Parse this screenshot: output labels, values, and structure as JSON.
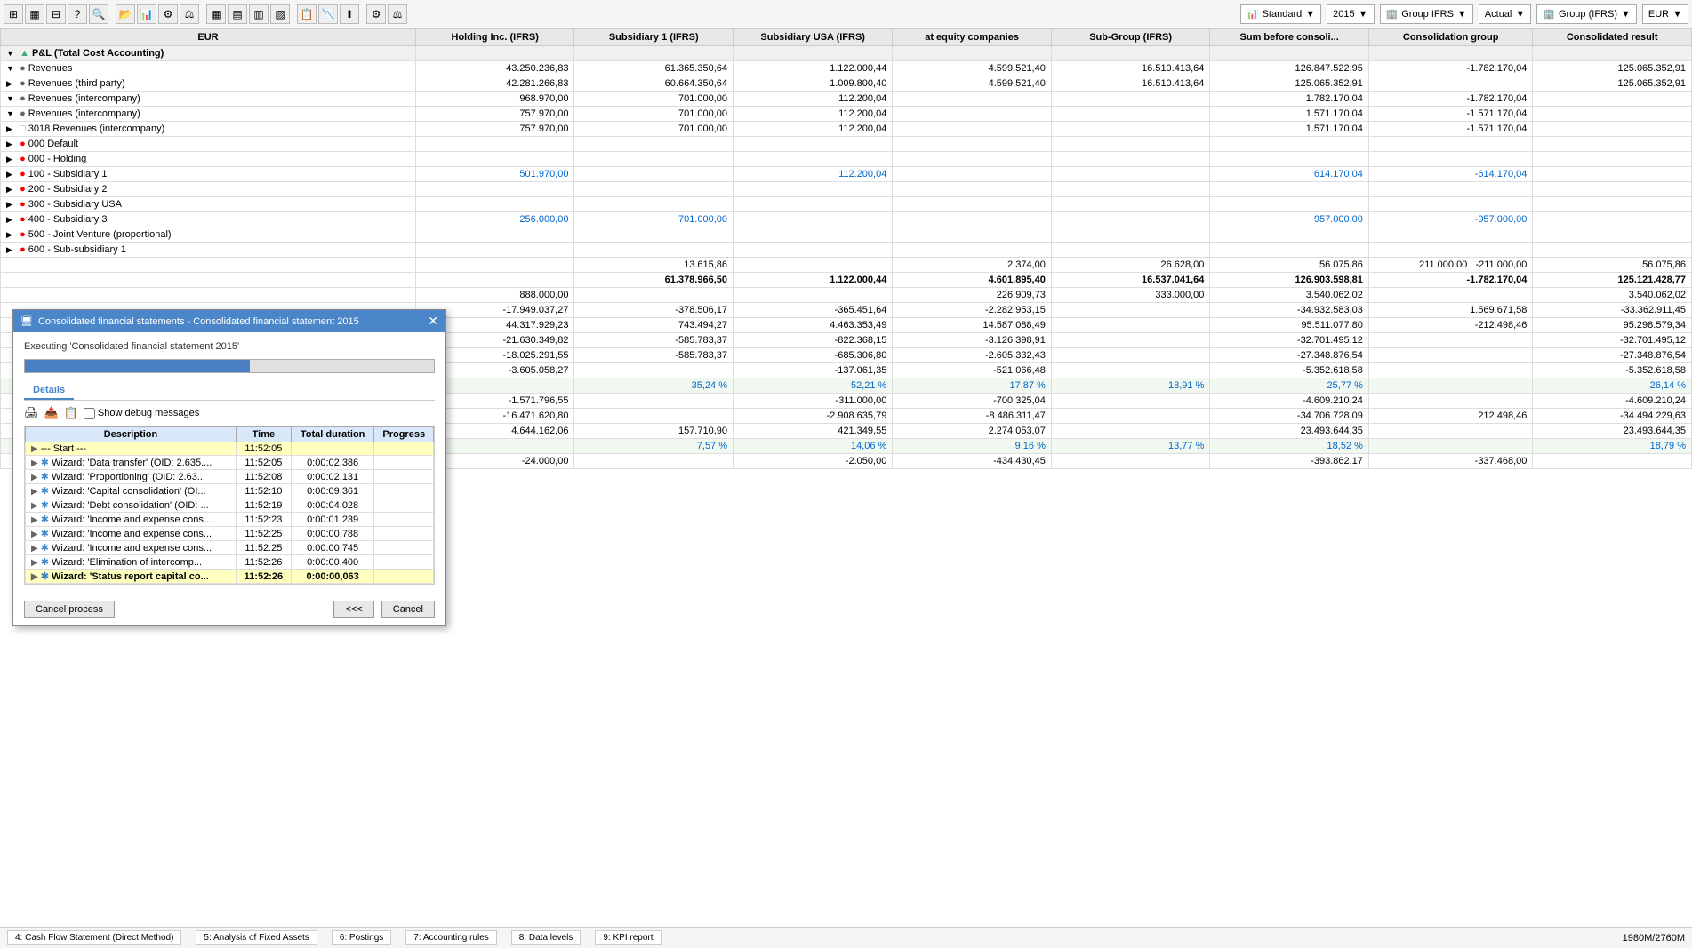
{
  "toolbar": {
    "dropdowns": [
      {
        "label": "Standard",
        "icon": "▼"
      },
      {
        "label": "2015",
        "icon": "▼"
      },
      {
        "label": "Group IFRS",
        "icon": "▼"
      },
      {
        "label": "Actual",
        "icon": "▼"
      },
      {
        "label": "Group (IFRS)",
        "icon": "▼"
      },
      {
        "label": "EUR",
        "icon": "▼"
      }
    ]
  },
  "table": {
    "eur_label": "EUR",
    "columns": [
      "Holding Inc. (IFRS)",
      "Subsidiary 1 (IFRS)",
      "Subsidiary USA (IFRS)",
      "at equity companies",
      "Sub-Group (IFRS)",
      "Sum before consoli...",
      "Consolidation group",
      "Consolidated result"
    ],
    "rows": [
      {
        "indent": 0,
        "type": "group",
        "icon": "▼",
        "bullet": "▲",
        "label": "P&L (Total Cost Accounting)",
        "vals": [
          "",
          "",
          "",
          "",
          "",
          "",
          "",
          ""
        ]
      },
      {
        "indent": 1,
        "type": "subgroup",
        "icon": "▼",
        "bullet": "●",
        "label": "Revenues",
        "vals": [
          "43.250.236,83",
          "61.365.350,64",
          "1.122.000,44",
          "4.599.521,40",
          "16.510.413,64",
          "126.847.522,95",
          "-1.782.170,04",
          "125.065.352,91"
        ]
      },
      {
        "indent": 2,
        "type": "item",
        "icon": "▶",
        "bullet": "●",
        "label": "Revenues (third party)",
        "vals": [
          "42.281.266,83",
          "60.664.350,64",
          "1.009.800,40",
          "4.599.521,40",
          "16.510.413,64",
          "125.065.352,91",
          "",
          "125.065.352,91"
        ]
      },
      {
        "indent": 2,
        "type": "item",
        "icon": "▼",
        "bullet": "●",
        "label": "Revenues (intercompany)",
        "vals": [
          "968.970,00",
          "701.000,00",
          "112.200,04",
          "",
          "",
          "1.782.170,04",
          "-1.782.170,04",
          ""
        ]
      },
      {
        "indent": 3,
        "type": "item",
        "icon": "▼",
        "bullet": "●",
        "label": "Revenues (intercompany)",
        "vals": [
          "757.970,00",
          "701.000,00",
          "112.200,04",
          "",
          "",
          "1.571.170,04",
          "-1.571.170,04",
          ""
        ]
      },
      {
        "indent": 4,
        "type": "item",
        "icon": "▶",
        "bullet": "□",
        "label": "3018 Revenues (intercompany)",
        "vals": [
          "757.970,00",
          "701.000,00",
          "112.200,04",
          "",
          "",
          "1.571.170,04",
          "-1.571.170,04",
          ""
        ]
      },
      {
        "indent": 4,
        "type": "leaf",
        "icon": "▶",
        "bullet": "●",
        "label": "000 Default",
        "vals": [
          "",
          "",
          "",
          "",
          "",
          "",
          "",
          ""
        ]
      },
      {
        "indent": 4,
        "type": "leaf",
        "icon": "▶",
        "bullet": "●",
        "label": "000 - Holding",
        "vals": [
          "",
          "",
          "",
          "",
          "",
          "",
          "",
          ""
        ]
      },
      {
        "indent": 4,
        "type": "leaf",
        "icon": "▶",
        "bullet": "●",
        "label": "100 - Subsidiary 1",
        "vals": [
          "501.970,00",
          "",
          "112.200,04",
          "",
          "",
          "614.170,04",
          "-614.170,04",
          ""
        ],
        "blue": [
          0,
          2,
          5,
          6
        ]
      },
      {
        "indent": 4,
        "type": "leaf",
        "icon": "▶",
        "bullet": "●",
        "label": "200 - Subsidiary 2",
        "vals": [
          "",
          "",
          "",
          "",
          "",
          "",
          "",
          ""
        ]
      },
      {
        "indent": 4,
        "type": "leaf",
        "icon": "▶",
        "bullet": "●",
        "label": "300 - Subsidiary USA",
        "vals": [
          "",
          "",
          "",
          "",
          "",
          "",
          "",
          ""
        ]
      },
      {
        "indent": 4,
        "type": "leaf",
        "icon": "▶",
        "bullet": "●",
        "label": "400 - Subsidiary 3",
        "vals": [
          "256.000,00",
          "701.000,00",
          "",
          "",
          "",
          "957.000,00",
          "-957.000,00",
          ""
        ],
        "blue": [
          0,
          1,
          5,
          6
        ]
      },
      {
        "indent": 4,
        "type": "leaf",
        "icon": "▶",
        "bullet": "●",
        "label": "500 - Joint Venture (proportional)",
        "vals": [
          "",
          "",
          "",
          "",
          "",
          "",
          "",
          ""
        ]
      },
      {
        "indent": 4,
        "type": "leaf",
        "icon": "▶",
        "bullet": "●",
        "label": "600 - Sub-subsidiary 1",
        "vals": [
          "",
          "",
          "",
          "",
          "",
          "",
          "",
          ""
        ]
      },
      {
        "indent": 0,
        "type": "spacer",
        "label": "",
        "vals": [
          "",
          "13.615,86",
          "",
          "2.374,00",
          "26.628,00",
          "56.075,86",
          "",
          "211.000,00",
          "-211.000,00",
          "56.075,86"
        ]
      },
      {
        "indent": 0,
        "type": "total",
        "label": "",
        "vals": [
          "",
          "61.378.966,50",
          "1.122.000,44",
          "4.601.895,40",
          "16.537.041,64",
          "126.903.598,81",
          "-1.782.170,04",
          "125.121.428,77"
        ]
      },
      {
        "indent": 0,
        "type": "item2",
        "label": "",
        "vals": [
          "888.000,00",
          "",
          "",
          "226.909,73",
          "333.000,00",
          "3.540.062,02",
          "",
          "3.540.062,02"
        ]
      },
      {
        "indent": 0,
        "type": "item2",
        "label": "",
        "vals": [
          "-17.949.037,27",
          "-378.506,17",
          "-365.451,64",
          "-2.282.953,15",
          "-34.932.583,03",
          "1.569.671,58",
          "-33.362.911,45",
          ""
        ]
      },
      {
        "indent": 0,
        "type": "item2",
        "label": "",
        "vals": [
          "44.317.929,23",
          "743.494,27",
          "4.463.353,49",
          "14.587.088,49",
          "95.511.077,80",
          "-212.498,46",
          "95.298.579,34",
          ""
        ]
      },
      {
        "indent": 0,
        "type": "item2",
        "label": "",
        "vals": [
          "-21.630.349,82",
          "-585.783,37",
          "-822.368,15",
          "-3.126.398,91",
          "-32.701.495,12",
          "",
          "-32.701.495,12",
          ""
        ]
      },
      {
        "indent": 0,
        "type": "item2",
        "label": "",
        "vals": [
          "-18.025.291,55",
          "-585.783,37",
          "-685.306,80",
          "-2.605.332,43",
          "-27.348.876,54",
          "",
          "-27.348.876,54",
          ""
        ]
      },
      {
        "indent": 0,
        "type": "item2",
        "label": "",
        "vals": [
          "-3.605.058,27",
          "",
          "-137.061,35",
          "-521.066,48",
          "-5.352.618,58",
          "",
          "-5.352.618,58",
          ""
        ]
      },
      {
        "indent": 0,
        "type": "pct",
        "label": "",
        "vals": [
          "",
          "35,24 %",
          "52,21 %",
          "17,87 %",
          "18,91 %",
          "25,77 %",
          "",
          "26,14 %"
        ]
      },
      {
        "indent": 0,
        "type": "item2",
        "label": "",
        "vals": [
          "-1.571.796,55",
          "",
          "-311.000,00",
          "-700.325,04",
          "-4.609.210,24",
          "",
          "-4.609.210,24",
          ""
        ]
      },
      {
        "indent": 0,
        "type": "item2",
        "label": "",
        "vals": [
          "-16.471.620,80",
          "",
          "-2.908.635,79",
          "-8.486.311,47",
          "-34.706.728,09",
          "212.498,46",
          "-34.494.229,63",
          ""
        ]
      },
      {
        "indent": 0,
        "type": "item2",
        "label": "",
        "vals": [
          "4.644.162,06",
          "157.710,90",
          "421.349,55",
          "2.274.053,07",
          "23.493.644,35",
          "",
          "23.493.644,35",
          ""
        ]
      },
      {
        "indent": 0,
        "type": "pct2",
        "label": "",
        "vals": [
          "",
          "7,57 %",
          "14,06 %",
          "9,16 %",
          "13,77 %",
          "18,52 %",
          "",
          "18,79 %"
        ]
      },
      {
        "indent": 0,
        "type": "item2",
        "label": "",
        "vals": [
          "-24.000,00",
          "",
          "-2.050,00",
          "-434.430,45",
          "-393.862,17",
          "-337.468,00",
          "",
          ""
        ]
      }
    ]
  },
  "modal": {
    "title": "Consolidated financial statements - Consolidated financial statement 2015",
    "executing_label": "Executing 'Consolidated financial statement 2015'",
    "progress": 55,
    "tabs": [
      "Details"
    ],
    "active_tab": "Details",
    "debug_label": "Show debug messages",
    "log_headers": [
      "Description",
      "Time",
      "Total duration",
      "Progress"
    ],
    "log_rows": [
      {
        "expand": false,
        "label": "--- Start ---",
        "time": "11:52:05",
        "duration": "",
        "progress": "",
        "selected": true
      },
      {
        "expand": true,
        "label": "Wizard: 'Data transfer' (OID: 2.635....",
        "time": "11:52:05",
        "duration": "0:00:02,386",
        "progress": ""
      },
      {
        "expand": true,
        "label": "Wizard: 'Proportioning' (OID: 2.63...",
        "time": "11:52:08",
        "duration": "0:00:02,131",
        "progress": ""
      },
      {
        "expand": true,
        "label": "Wizard: 'Capital consolidation' (OI...",
        "time": "11:52:10",
        "duration": "0:00:09,361",
        "progress": ""
      },
      {
        "expand": true,
        "label": "Wizard: 'Debt consolidation' (OID: ...",
        "time": "11:52:19",
        "duration": "0:00:04,028",
        "progress": ""
      },
      {
        "expand": true,
        "label": "Wizard: 'Income and expense cons...",
        "time": "11:52:23",
        "duration": "0:00:01,239",
        "progress": ""
      },
      {
        "expand": true,
        "label": "Wizard: 'Income and expense cons...",
        "time": "11:52:25",
        "duration": "0:00:00,788",
        "progress": ""
      },
      {
        "expand": true,
        "label": "Wizard: 'Income and expense cons...",
        "time": "11:52:25",
        "duration": "0:00:00,745",
        "progress": ""
      },
      {
        "expand": true,
        "label": "Wizard: 'Elimination of intercomp...",
        "time": "11:52:26",
        "duration": "0:00:00,400",
        "progress": ""
      },
      {
        "expand": true,
        "label": "Wizard: 'Status report capital co...",
        "time": "11:52:26",
        "duration": "0:00:00,063",
        "progress": "",
        "running": true
      }
    ],
    "cancel_process_label": "Cancel process",
    "nav_prev": "<<<",
    "cancel_label": "Cancel"
  },
  "statusbar": {
    "tabs": [
      "4: Cash Flow Statement (Direct Method)",
      "5: Analysis of Fixed Assets",
      "6: Postings",
      "7: Accounting rules",
      "8: Data levels",
      "9: KPI report"
    ],
    "memory": "1980M/2760M"
  }
}
